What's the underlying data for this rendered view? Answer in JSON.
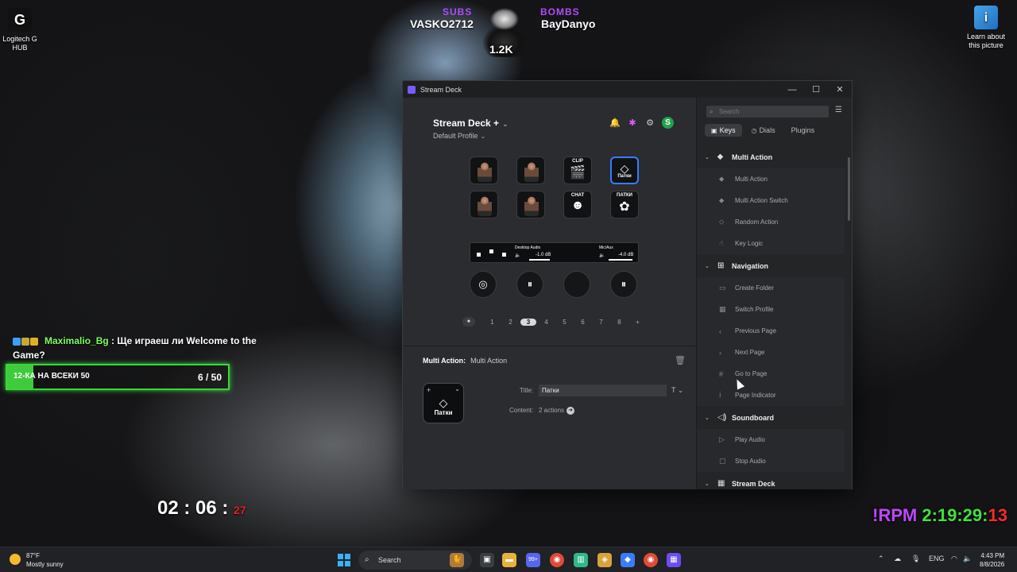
{
  "desktop": {
    "logitech": {
      "label": "Logitech G HUB"
    },
    "learn": {
      "label": "Learn about this picture"
    }
  },
  "overlay": {
    "subs_label": "SUBS",
    "subs_name": "VASKO2712",
    "bombs_label": "BOMBS",
    "bombs_name": "BayDanyo",
    "mascot_count": "1.2K",
    "chat_user": "Maximalio_Bg",
    "chat_message": " : Ще играеш ли Welcome to the Game?",
    "goal_label": "12-КА НА ВСЕКИ 50",
    "goal_count": "6 / 50",
    "goal_progress": 0.12,
    "timer_main": "02 : 06 : ",
    "timer_sec": "27",
    "rpm_word": "!RPM ",
    "rpm_time": "2:19:29:",
    "rpm_ms": "13"
  },
  "window": {
    "title": "Stream Deck",
    "minimize": "—",
    "maximize": "☐",
    "close": "✕"
  },
  "deck": {
    "device": "Stream Deck +",
    "profile": "Default Profile",
    "keys": [
      {
        "type": "image"
      },
      {
        "type": "image"
      },
      {
        "label": "CLIP",
        "glyph": "🎬"
      },
      {
        "glyph": "◇",
        "sub": "Патки"
      },
      {
        "type": "image"
      },
      {
        "type": "image"
      },
      {
        "label": "CHAT",
        "glyph": "☻"
      },
      {
        "label": "ПАТКИ",
        "glyph": "✿"
      }
    ],
    "touch_strip": {
      "left_label": "Desktop Audio",
      "left_value": "-1.0 dB",
      "right_label": "Mic/Aux",
      "right_value": "-4.0 dB"
    },
    "dials": [
      "◎",
      "⏸",
      "",
      "⏸"
    ],
    "pages": [
      "1",
      "2",
      "3",
      "4",
      "5",
      "6",
      "7",
      "8"
    ],
    "active_page": "3",
    "pin_glyph": "✦",
    "add_page": "+"
  },
  "inspector": {
    "header_label": "Multi Action:",
    "header_value": "Multi Action",
    "key_name": "Патки",
    "title_label": "Title:",
    "title_value": "Патки",
    "title_tools": "T ⌄",
    "content_label": "Content:",
    "content_value": "2 actions"
  },
  "actions_panel": {
    "search_placeholder": "Search",
    "tabs": [
      {
        "label": "Keys",
        "icon": "▣",
        "active": true
      },
      {
        "label": "Dials",
        "icon": "◷",
        "active": false
      },
      {
        "label": "Plugins",
        "icon": "",
        "active": false
      }
    ],
    "categories": [
      {
        "name": "Multi Action",
        "icon": "⬥",
        "items": [
          {
            "label": "Multi Action",
            "icon": "⬥"
          },
          {
            "label": "Multi Action Switch",
            "icon": "⬥"
          },
          {
            "label": "Random Action",
            "icon": "⬦"
          },
          {
            "label": "Key Logic",
            "icon": "☝"
          }
        ]
      },
      {
        "name": "Navigation",
        "icon": "⊞",
        "items": [
          {
            "label": "Create Folder",
            "icon": "▭"
          },
          {
            "label": "Switch Profile",
            "icon": "▦"
          },
          {
            "label": "Previous Page",
            "icon": "‹"
          },
          {
            "label": "Next Page",
            "icon": "›"
          },
          {
            "label": "Go to Page",
            "icon": "#"
          },
          {
            "label": "Page Indicator",
            "icon": "ⅰ"
          }
        ]
      },
      {
        "name": "Soundboard",
        "icon": "◁)",
        "items": [
          {
            "label": "Play Audio",
            "icon": "▷"
          },
          {
            "label": "Stop Audio",
            "icon": "▢"
          }
        ]
      },
      {
        "name": "Stream Deck",
        "icon": "▦",
        "items": []
      }
    ]
  },
  "taskbar": {
    "weather_temp": "87°F",
    "weather_desc": "Mostly sunny",
    "search_label": "Search",
    "language": "ENG",
    "time": "4:43 PM",
    "date": "8/8/2026",
    "discord_badge": "99+"
  },
  "colors": {
    "accent": "#3a7bff",
    "subs": "#b04cff",
    "goal": "#3fcb3c",
    "rpm_time": "#3fe03f",
    "rpm_ms": "#ff2a2a"
  }
}
